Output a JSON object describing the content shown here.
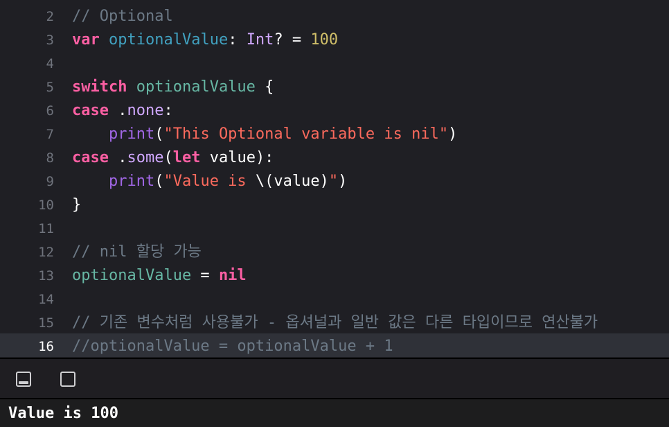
{
  "editor": {
    "current_line": "16",
    "lines": [
      {
        "number": "2",
        "tokens": [
          {
            "t": "// Optional",
            "c": "cm"
          }
        ]
      },
      {
        "number": "3",
        "tokens": [
          {
            "t": "var",
            "c": "kw"
          },
          {
            "t": " ",
            "c": "plain"
          },
          {
            "t": "optionalValue",
            "c": "decl"
          },
          {
            "t": ": ",
            "c": "plain"
          },
          {
            "t": "Int",
            "c": "type"
          },
          {
            "t": "? = ",
            "c": "plain"
          },
          {
            "t": "100",
            "c": "num"
          }
        ]
      },
      {
        "number": "4",
        "tokens": []
      },
      {
        "number": "5",
        "tokens": [
          {
            "t": "switch",
            "c": "kw"
          },
          {
            "t": " ",
            "c": "plain"
          },
          {
            "t": "optionalValue",
            "c": "ident"
          },
          {
            "t": " {",
            "c": "plain"
          }
        ]
      },
      {
        "number": "6",
        "tokens": [
          {
            "t": "case",
            "c": "kw"
          },
          {
            "t": " .",
            "c": "plain"
          },
          {
            "t": "none",
            "c": "type"
          },
          {
            "t": ":",
            "c": "plain"
          }
        ]
      },
      {
        "number": "7",
        "tokens": [
          {
            "t": "    ",
            "c": "plain"
          },
          {
            "t": "print",
            "c": "fn"
          },
          {
            "t": "(",
            "c": "plain"
          },
          {
            "t": "\"This Optional variable is nil\"",
            "c": "str"
          },
          {
            "t": ")",
            "c": "plain"
          }
        ]
      },
      {
        "number": "8",
        "tokens": [
          {
            "t": "case",
            "c": "kw"
          },
          {
            "t": " .",
            "c": "plain"
          },
          {
            "t": "some",
            "c": "type"
          },
          {
            "t": "(",
            "c": "plain"
          },
          {
            "t": "let",
            "c": "kw"
          },
          {
            "t": " value):",
            "c": "plain"
          }
        ]
      },
      {
        "number": "9",
        "tokens": [
          {
            "t": "    ",
            "c": "plain"
          },
          {
            "t": "print",
            "c": "fn"
          },
          {
            "t": "(",
            "c": "plain"
          },
          {
            "t": "\"Value is ",
            "c": "str"
          },
          {
            "t": "\\(value)",
            "c": "plain"
          },
          {
            "t": "\"",
            "c": "str"
          },
          {
            "t": ")",
            "c": "plain"
          }
        ]
      },
      {
        "number": "10",
        "tokens": [
          {
            "t": "}",
            "c": "plain"
          }
        ]
      },
      {
        "number": "11",
        "tokens": []
      },
      {
        "number": "12",
        "tokens": [
          {
            "t": "// nil 할당 가능",
            "c": "cm"
          }
        ]
      },
      {
        "number": "13",
        "tokens": [
          {
            "t": "optionalValue",
            "c": "ident"
          },
          {
            "t": " = ",
            "c": "plain"
          },
          {
            "t": "nil",
            "c": "kw"
          }
        ]
      },
      {
        "number": "14",
        "tokens": []
      },
      {
        "number": "15",
        "tokens": [
          {
            "t": "// 기존 변수처럼 사용불가 - 옵셔널과 일반 값은 다른 타입이므로 연산불가",
            "c": "cm"
          }
        ]
      },
      {
        "number": "16",
        "tokens": [
          {
            "t": "//optionalValue = optionalValue + 1",
            "c": "cm"
          }
        ]
      }
    ]
  },
  "debug_bar": {
    "hide_debug_icon": "hide-debug-area-icon",
    "show_console_icon": "show-console-icon"
  },
  "console": {
    "output": "Value is 100"
  },
  "colors": {
    "background": "#1f1f24",
    "keyword": "#fc5fa3",
    "string": "#fc6a5d",
    "number": "#d0bf69",
    "comment": "#6c7986",
    "type": "#d0a8ff",
    "function": "#a167e6",
    "identifier": "#67b7a4",
    "declaration": "#41a1c0"
  }
}
